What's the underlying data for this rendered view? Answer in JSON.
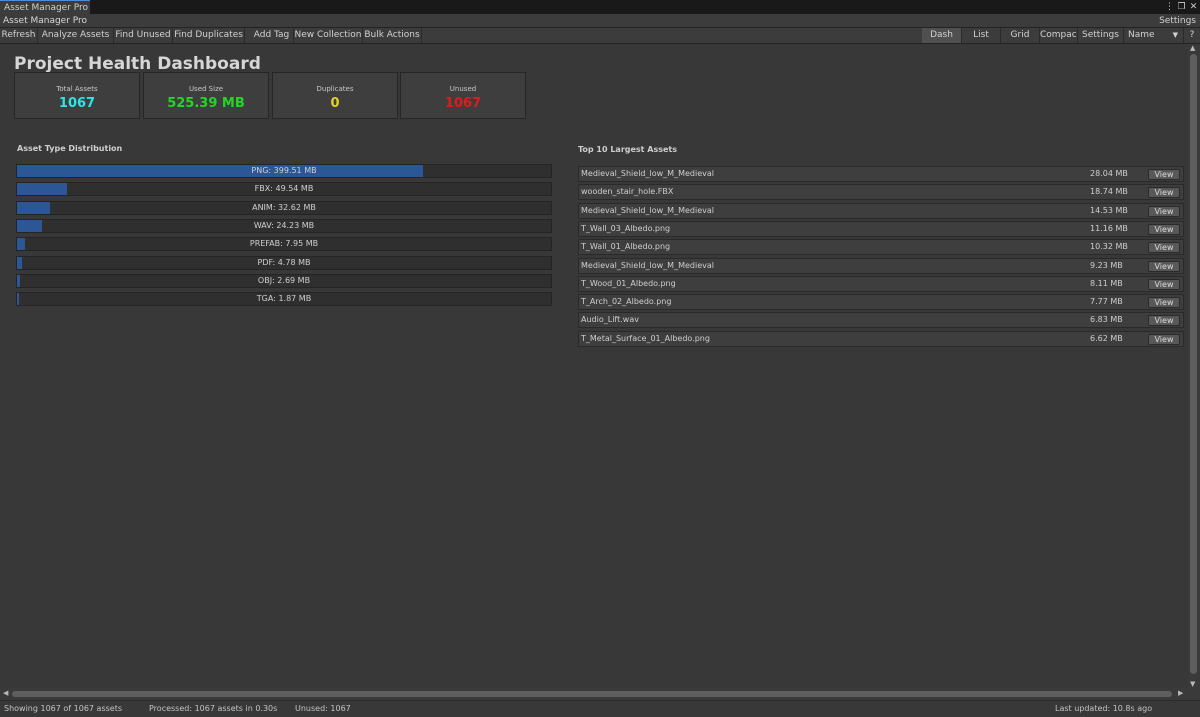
{
  "window": {
    "tab_label": "Asset Manager Pro",
    "app_title": "Asset Manager Pro",
    "settings_label": "Settings"
  },
  "toolbar": {
    "left_buttons": [
      "Refresh",
      "Analyze Assets",
      "Find Unused",
      "Find Duplicates",
      "Add Tag",
      "New Collection",
      "Bulk Actions"
    ],
    "view_buttons": [
      "Dash",
      "List",
      "Grid",
      "Compact"
    ],
    "active_view": "Dash",
    "settings_label": "Settings",
    "sort_value": "Name",
    "help_label": "?"
  },
  "dashboard": {
    "title": "Project Health Dashboard",
    "stats": [
      {
        "label": "Total Assets",
        "value": "1067",
        "color": "#2ee6e6"
      },
      {
        "label": "Used Size",
        "value": "525.39 MB",
        "color": "#22d822"
      },
      {
        "label": "Duplicates",
        "value": "0",
        "color": "#e6d21e"
      },
      {
        "label": "Unused",
        "value": "1067",
        "color": "#e81818"
      }
    ]
  },
  "distribution": {
    "title": "Asset Type Distribution",
    "bar_color": "#2b5797",
    "items": [
      {
        "label": "PNG: 399.51 MB",
        "mb": 399.51
      },
      {
        "label": "FBX: 49.54 MB",
        "mb": 49.54
      },
      {
        "label": "ANIM: 32.62 MB",
        "mb": 32.62
      },
      {
        "label": "WAV: 24.23 MB",
        "mb": 24.23
      },
      {
        "label": "PREFAB: 7.95 MB",
        "mb": 7.95
      },
      {
        "label": "PDF: 4.78 MB",
        "mb": 4.78
      },
      {
        "label": "OBJ: 2.69 MB",
        "mb": 2.69
      },
      {
        "label": "TGA: 1.87 MB",
        "mb": 1.87
      }
    ]
  },
  "largest": {
    "title": "Top 10 Largest Assets",
    "view_label": "View",
    "items": [
      {
        "name": "Medieval_Shield_low_M_Medieval",
        "size": "28.04 MB"
      },
      {
        "name": "wooden_stair_hole.FBX",
        "size": "18.74 MB"
      },
      {
        "name": "Medieval_Shield_low_M_Medieval",
        "size": "14.53 MB"
      },
      {
        "name": "T_Wall_03_Albedo.png",
        "size": "11.16 MB"
      },
      {
        "name": "T_Wall_01_Albedo.png",
        "size": "10.32 MB"
      },
      {
        "name": "Medieval_Shield_low_M_Medieval",
        "size": "9.23 MB"
      },
      {
        "name": "T_Wood_01_Albedo.png",
        "size": "8.11 MB"
      },
      {
        "name": "T_Arch_02_Albedo.png",
        "size": "7.77 MB"
      },
      {
        "name": "Audio_Lift.wav",
        "size": "6.83 MB"
      },
      {
        "name": "T_Metal_Surface_01_Albedo.png",
        "size": "6.62 MB"
      }
    ]
  },
  "status": {
    "showing": "Showing 1067 of 1067 assets",
    "processed": "Processed: 1067 assets in 0.30s",
    "unused": "Unused: 1067",
    "last_updated": "Last updated: 10.8s ago"
  },
  "icons": [
    "kebab-menu-icon",
    "maximize-icon",
    "close-icon",
    "dropdown-caret-icon",
    "scroll-arrow-up-icon",
    "scroll-arrow-down-icon",
    "scroll-arrow-left-icon",
    "scroll-arrow-right-icon"
  ]
}
